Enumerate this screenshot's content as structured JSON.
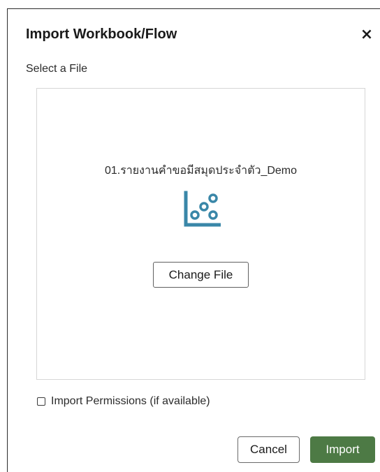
{
  "dialog": {
    "title": "Import Workbook/Flow",
    "close_label": "×"
  },
  "file_section": {
    "label": "Select a File",
    "file_name": "01.รายงานคำขอมีสมุดประจำตัว_Demo",
    "file_icon": "workbook-scatter-icon",
    "change_file_label": "Change File"
  },
  "options": {
    "import_permissions_label": "Import Permissions (if available)",
    "import_permissions_checked": false
  },
  "footer": {
    "cancel_label": "Cancel",
    "import_label": "Import"
  },
  "colors": {
    "accent_icon": "#3a87a8",
    "import_button": "#4d7a45",
    "panel_border": "#d6d6d6"
  }
}
